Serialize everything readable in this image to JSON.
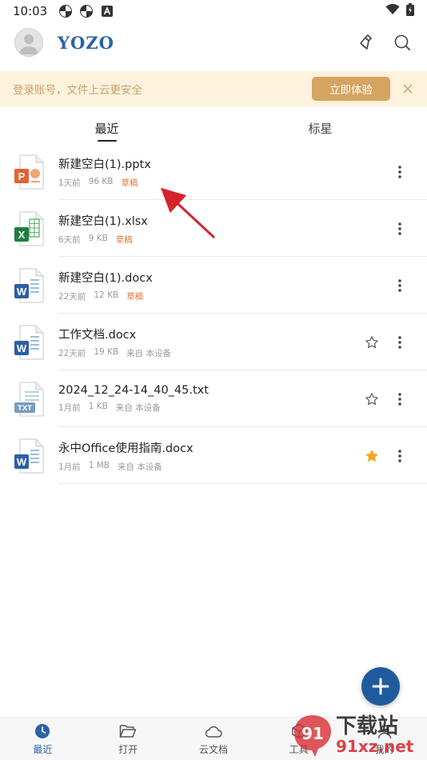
{
  "status": {
    "time": "10:03",
    "icons": [
      "pinwheel-icon",
      "pinwheel-icon",
      "a-icon"
    ],
    "right_icons": [
      "wifi-icon",
      "battery-icon"
    ]
  },
  "header": {
    "logo": "YOZO",
    "actions": [
      "clean-icon",
      "search-icon"
    ]
  },
  "banner": {
    "text": "登录账号，文件上云更安全",
    "button": "立即体验"
  },
  "tabs": [
    {
      "label": "最近",
      "active": true
    },
    {
      "label": "标星",
      "active": false
    }
  ],
  "files": [
    {
      "name": "新建空白(1).pptx",
      "time": "1天前",
      "size": "96 KB",
      "tag": "草稿",
      "type": "ppt",
      "star": "none"
    },
    {
      "name": "新建空白(1).xlsx",
      "time": "6天前",
      "size": "9 KB",
      "tag": "草稿",
      "type": "xls",
      "star": "none"
    },
    {
      "name": "新建空白(1).docx",
      "time": "22天前",
      "size": "12 KB",
      "tag": "草稿",
      "type": "doc",
      "star": "none"
    },
    {
      "name": "工作文档.docx",
      "time": "22天前",
      "size": "19 KB",
      "tag": "来自 本设备",
      "type": "doc",
      "star": "empty"
    },
    {
      "name": "2024_12_24-14_40_45.txt",
      "time": "1月前",
      "size": "1 KB",
      "tag": "来自 本设备",
      "type": "txt",
      "star": "empty"
    },
    {
      "name": "永中Office使用指南.docx",
      "time": "1月前",
      "size": "1 MB",
      "tag": "来自 本设备",
      "type": "doc",
      "star": "filled"
    }
  ],
  "bottom_nav": [
    {
      "label": "最近",
      "icon": "clock-icon",
      "active": true
    },
    {
      "label": "打开",
      "icon": "folder-icon",
      "active": false
    },
    {
      "label": "云文档",
      "icon": "cloud-icon",
      "active": false
    },
    {
      "label": "工具",
      "icon": "toolbox-icon",
      "active": false
    },
    {
      "label": "我的",
      "icon": "user-icon",
      "active": false
    }
  ],
  "watermark": {
    "top": "下载站",
    "bottom": "91xz.net"
  },
  "colors": {
    "brand": "#2a63a8",
    "banner_bg": "#fdf2dc",
    "banner_btn": "#d5a461",
    "draft": "#e2783a",
    "star_filled": "#f5a623",
    "fab": "#1f5b9c"
  }
}
